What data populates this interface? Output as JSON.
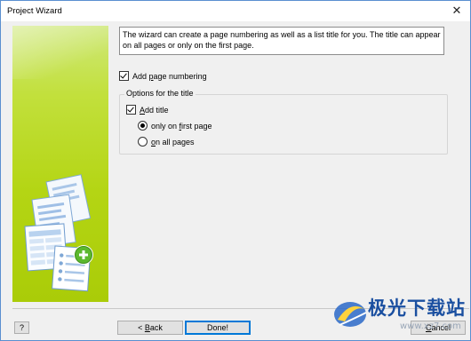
{
  "window": {
    "title": "Project Wizard",
    "close_glyph": "✕"
  },
  "description": "The wizard can create a page numbering as well as a list title for you. The title can appear on all pages or only on the first page.",
  "add_page_numbering": {
    "label_pre": "Add ",
    "label_key": "p",
    "label_post": "age numbering",
    "checked": true
  },
  "options_group": {
    "label": "Options for the title",
    "add_title": {
      "label_pre": "",
      "label_key": "A",
      "label_post": "dd title",
      "checked": true
    },
    "radio_first": {
      "label_pre": "only on ",
      "label_key": "f",
      "label_post": "irst page",
      "selected": true
    },
    "radio_all": {
      "label_pre": "",
      "label_key": "o",
      "label_post": "n all pages",
      "selected": false
    }
  },
  "buttons": {
    "help_glyph": "?",
    "back": {
      "prefix": "< ",
      "key": "B",
      "rest": "ack"
    },
    "done": "Done!",
    "cancel": {
      "key": "C",
      "rest": "ancel"
    }
  },
  "watermark": {
    "text": "极光下载站",
    "url": "www.xz7.com"
  },
  "colors": {
    "side_panel": "#b4d514",
    "accent": "#0078d7"
  }
}
